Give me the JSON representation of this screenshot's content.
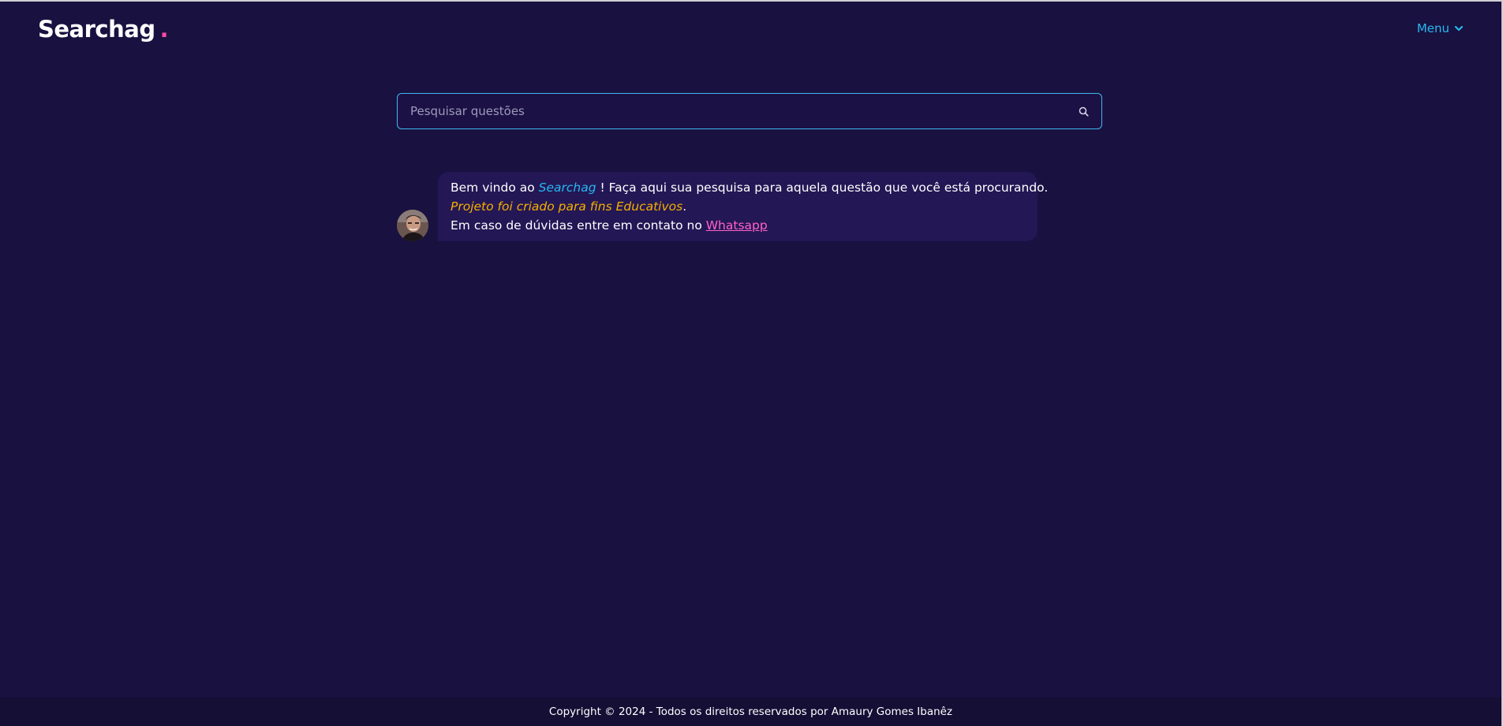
{
  "header": {
    "logo_text": "Searchag",
    "logo_dot": ".",
    "menu_label": "Menu",
    "menu_icon": "chevron-down-icon"
  },
  "search": {
    "placeholder": "Pesquisar questões",
    "value": "",
    "icon": "search-icon"
  },
  "chat": {
    "avatar_icon": "user-photo",
    "line1_prefix": "Bem vindo ao ",
    "line1_brand": "Searchag",
    "line1_suffix": " ! Faça aqui sua pesquisa para aquela questão que você está procurando.",
    "line2_note": "Projeto foi criado para fins Educativos",
    "line2_end": ".",
    "line3_prefix": "Em caso de dúvidas entre em contato no ",
    "line3_link": "Whatsapp"
  },
  "footer": {
    "copyright": "Copyright © 2024 - Todos os direitos reservados por Amaury Gomes Ibanêz"
  },
  "colors": {
    "background": "#191140",
    "accent": "#27b8ef",
    "logo_dot": "#ff4aa6",
    "highlight": "#f5b000",
    "link": "#ff62c8",
    "bubble": "#241755"
  }
}
